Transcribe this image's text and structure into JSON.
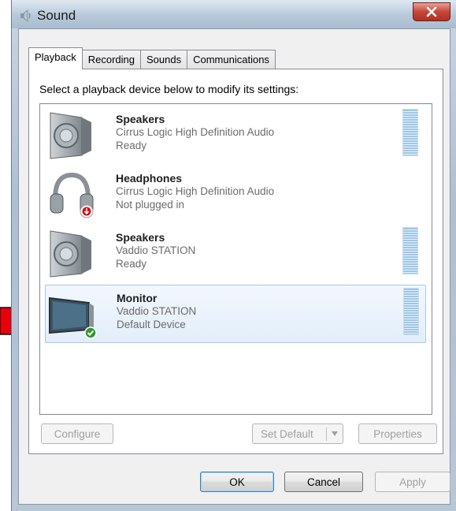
{
  "window": {
    "title": "Sound"
  },
  "tabs": [
    {
      "label": "Playback",
      "active": true
    },
    {
      "label": "Recording",
      "active": false
    },
    {
      "label": "Sounds",
      "active": false
    },
    {
      "label": "Communications",
      "active": false
    }
  ],
  "playback": {
    "instruction": "Select a playback device below to modify its settings:",
    "devices": [
      {
        "name": "Speakers",
        "driver": "Cirrus Logic High Definition Audio",
        "status": "Ready",
        "icon": "speaker-icon",
        "meter": true,
        "selected": false
      },
      {
        "name": "Headphones",
        "driver": "Cirrus Logic High Definition Audio",
        "status": "Not plugged in",
        "icon": "headphones-icon",
        "meter": false,
        "selected": false
      },
      {
        "name": "Speakers",
        "driver": "Vaddio STATION",
        "status": "Ready",
        "icon": "speaker-icon",
        "meter": true,
        "selected": false
      },
      {
        "name": "Monitor",
        "driver": "Vaddio STATION",
        "status": "Default Device",
        "icon": "monitor-icon",
        "meter": true,
        "selected": true
      }
    ],
    "buttons": {
      "configure": "Configure",
      "set_default": "Set Default",
      "properties": "Properties"
    }
  },
  "footer": {
    "ok": "OK",
    "cancel": "Cancel",
    "apply": "Apply"
  },
  "colors": {
    "arrow": "#e8000b",
    "selection": "#e3eefa",
    "close_button": "#c6463a"
  }
}
